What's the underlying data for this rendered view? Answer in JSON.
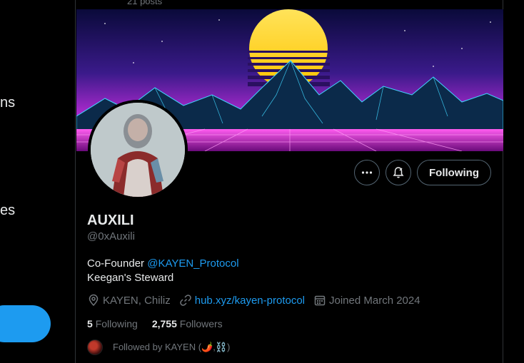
{
  "left_nav": {
    "fragment_1": "ns",
    "fragment_2": "es"
  },
  "header": {
    "posts_count": "21 posts"
  },
  "profile": {
    "display_name": "AUXILI",
    "handle": "@0xAuxili",
    "bio_prefix": "Co-Founder",
    "bio_mention": "@KAYEN_Protocol",
    "bio_line2": "Keegan's Steward",
    "location": "KAYEN, Chiliz",
    "website": "hub.xyz/kayen-protocol",
    "joined": "Joined March 2024",
    "following_count": "5",
    "following_label": "Following",
    "followers_count": "2,755",
    "followers_label": "Followers",
    "followed_by": "Followed by KAYEN (🌶️,⛓️)"
  },
  "actions": {
    "follow_label": "Following",
    "more_icon": "more-icon",
    "notify_icon": "bell-icon"
  },
  "colors": {
    "accent": "#1d9bf0",
    "muted": "#71767b",
    "text": "#e7e9ea",
    "background": "#000000"
  }
}
